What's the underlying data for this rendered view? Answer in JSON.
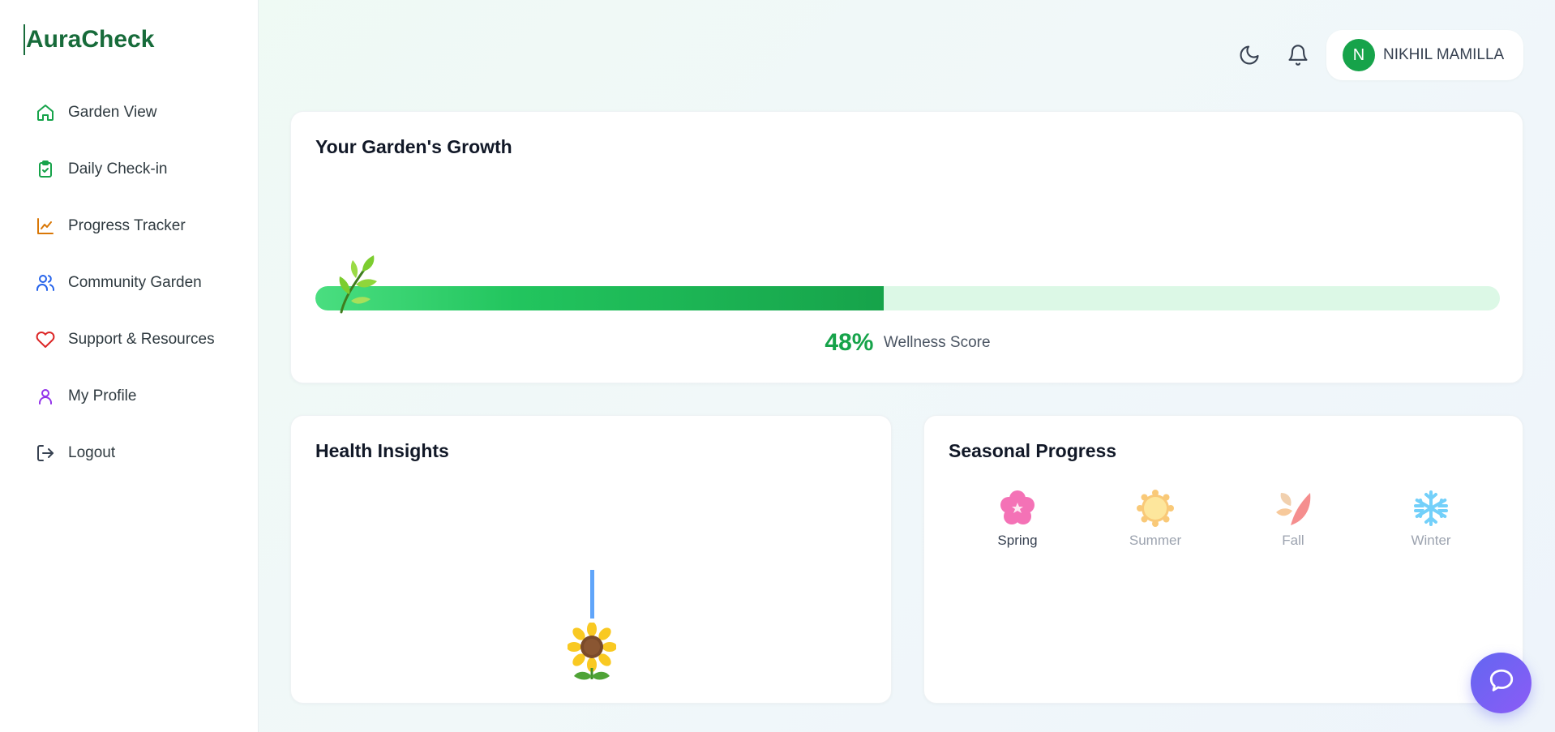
{
  "app": {
    "name": "AuraCheck",
    "brand_color": "#176b3a"
  },
  "sidebar": {
    "items": [
      {
        "label": "Garden View",
        "icon": "home-icon",
        "color": "#16a34a"
      },
      {
        "label": "Daily Check-in",
        "icon": "clipboard-check-icon",
        "color": "#16a34a"
      },
      {
        "label": "Progress Tracker",
        "icon": "line-chart-icon",
        "color": "#d97706"
      },
      {
        "label": "Community Garden",
        "icon": "users-icon",
        "color": "#2563eb"
      },
      {
        "label": "Support & Resources",
        "icon": "heart-icon",
        "color": "#dc2626"
      },
      {
        "label": "My Profile",
        "icon": "user-icon",
        "color": "#9333ea"
      },
      {
        "label": "Logout",
        "icon": "logout-icon",
        "color": "#374151"
      }
    ]
  },
  "topbar": {
    "theme_icon": "moon-icon",
    "notifications_icon": "bell-icon",
    "user": {
      "initial": "N",
      "name": "NIKHIL MAMILLA",
      "avatar_color": "#16a34a"
    }
  },
  "growth": {
    "title": "Your Garden's Growth",
    "score_value": "48%",
    "score_fraction": 0.48,
    "score_label": "Wellness Score",
    "icon": "sprout-icon"
  },
  "insights": {
    "title": "Health Insights",
    "icon": "sunflower-icon"
  },
  "seasonal": {
    "title": "Seasonal Progress",
    "seasons": [
      {
        "label": "Spring",
        "icon": "cherry-blossom-icon",
        "active": true
      },
      {
        "label": "Summer",
        "icon": "sun-icon",
        "active": false
      },
      {
        "label": "Fall",
        "icon": "fallen-leaf-icon",
        "active": false
      },
      {
        "label": "Winter",
        "icon": "snowflake-icon",
        "active": false
      }
    ]
  },
  "chat": {
    "icon": "chat-bubble-icon",
    "color": "#7c5cf5"
  }
}
